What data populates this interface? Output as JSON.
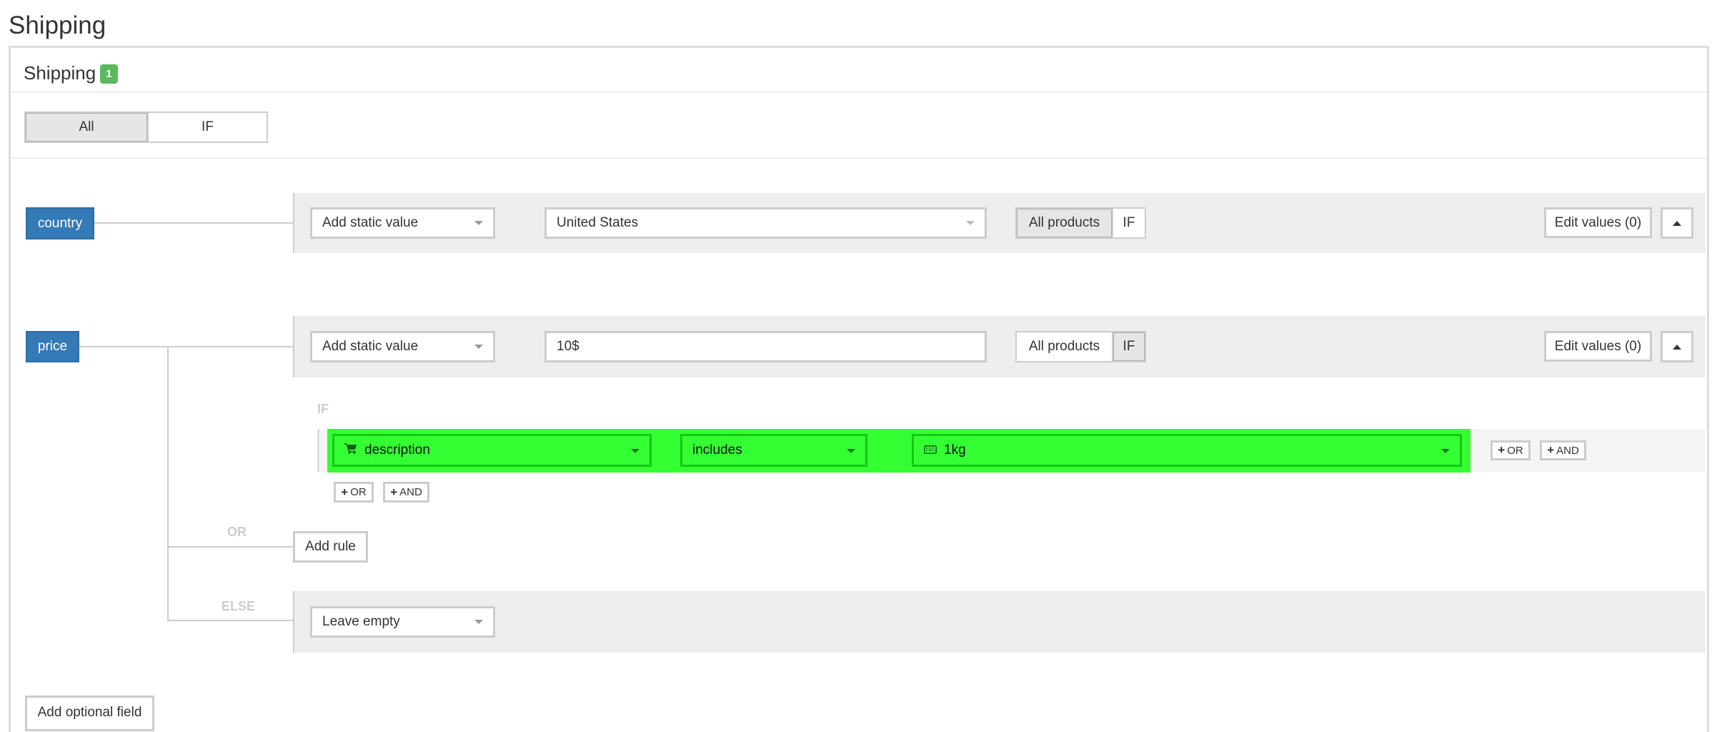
{
  "page": {
    "title": "Shipping"
  },
  "panel": {
    "title": "Shipping",
    "badge_count": "1",
    "mode_toggle": {
      "options": [
        "All",
        "IF"
      ],
      "selected": "All"
    }
  },
  "fields": {
    "country": {
      "label": "country",
      "source_select": "Add static value",
      "value_select": "United States",
      "scope_toggle": {
        "options": [
          "All products",
          "IF"
        ],
        "selected": "All products"
      },
      "edit_values": "Edit values (0)"
    },
    "price": {
      "label": "price",
      "source_select": "Add static value",
      "value_input": "10$",
      "scope_toggle": {
        "options": [
          "All products",
          "IF"
        ],
        "selected": "IF"
      },
      "edit_values": "Edit values (0)",
      "condition": {
        "if_label": "IF",
        "attribute": "description",
        "operator": "includes",
        "value": "1kg",
        "or_label": "OR",
        "and_label": "AND",
        "highlight_color": "#33ff33"
      },
      "or_branch": {
        "label": "OR",
        "add_rule": "Add rule"
      },
      "else_branch": {
        "label": "ELSE",
        "select": "Leave empty"
      }
    }
  },
  "footer": {
    "add_optional_field": "Add optional field"
  },
  "colors": {
    "field_label": "#337ab7",
    "badge": "#5cb85c",
    "band": "#eeeeee"
  }
}
